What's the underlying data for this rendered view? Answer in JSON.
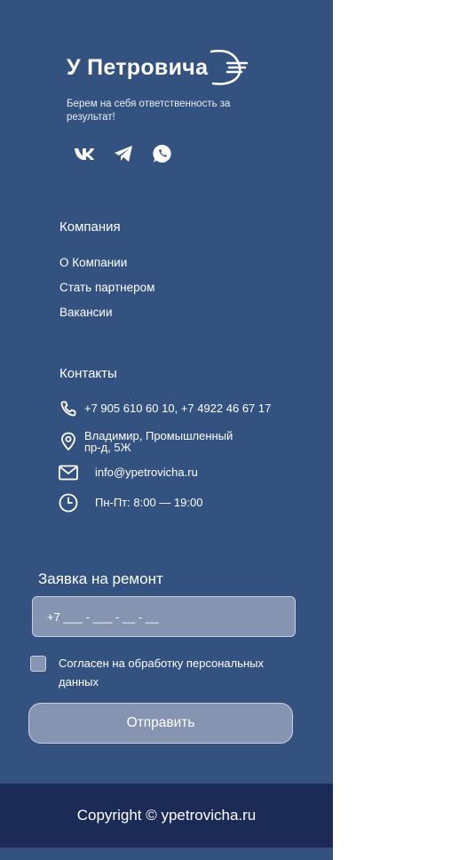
{
  "brand": {
    "name": "У Петровича",
    "tagline": "Берем на себя ответственность за результат!"
  },
  "social": [
    {
      "name": "vk-icon",
      "label": "VK"
    },
    {
      "name": "telegram-icon",
      "label": "Telegram"
    },
    {
      "name": "whatsapp-icon",
      "label": "WhatsApp"
    }
  ],
  "company": {
    "title": "Компания",
    "links": [
      "О Компании",
      "Стать  партнером",
      "Вакансии"
    ]
  },
  "contacts": {
    "title": "Контакты",
    "phones": "+7 905 610 60 10, +7 4922 46 67 17",
    "address_line1": "Владимир, Промышленный",
    "address_line2": "пр-д, 5Ж",
    "email": "info@ypetrovicha.ru",
    "hours": "Пн-Пт: 8:00 — 19:00"
  },
  "form": {
    "title": "Заявка на ремонт",
    "phone_placeholder": "+7 ___ - ___ - __ - __",
    "consent_label": "Согласен на обработку персональных данных",
    "submit_label": "Отправить"
  },
  "footer": {
    "copyright": "Copyright © ypetrovicha.ru"
  },
  "colors": {
    "panel_bg": "#34527F",
    "footer_bg": "#1C2B55",
    "field_bg": "#8595B1"
  }
}
